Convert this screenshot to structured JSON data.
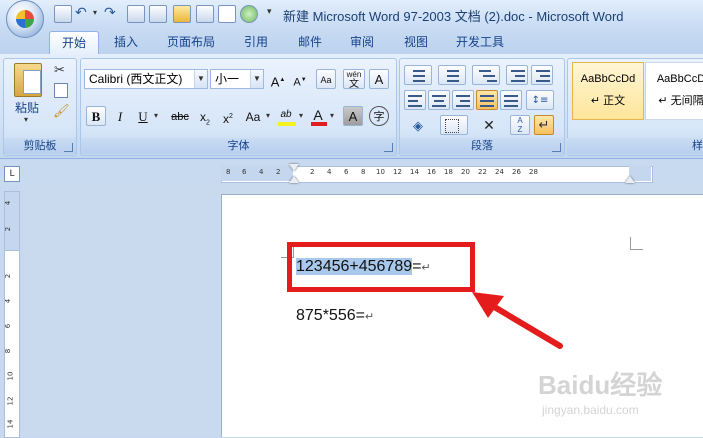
{
  "window": {
    "title": "新建 Microsoft Word 97-2003 文档 (2).doc - Microsoft Word"
  },
  "quick_access": {
    "icons": [
      "save-icon",
      "undo-icon",
      "redo-icon",
      "format-icon",
      "open-icon",
      "print-icon",
      "spellcheck-icon",
      "circle-icon"
    ]
  },
  "tabs": [
    "开始",
    "插入",
    "页面布局",
    "引用",
    "邮件",
    "审阅",
    "视图",
    "开发工具"
  ],
  "active_tab": "开始",
  "ribbon": {
    "clipboard": {
      "paste_label": "粘贴",
      "group_label": "剪贴板"
    },
    "font": {
      "font_name": "Calibri (西文正文)",
      "font_size": "小一",
      "group_label": "字体",
      "buttons": {
        "grow": "A",
        "shrink": "A",
        "clear": "Aa",
        "phonetic": "wén",
        "char_border": "A",
        "bold": "B",
        "italic": "I",
        "underline": "U",
        "strike": "abc",
        "subscript": "x",
        "superscript": "x",
        "change_case": "Aa",
        "highlight": "ab",
        "font_color": "A",
        "char_shading": "A",
        "enclose": "字"
      }
    },
    "paragraph": {
      "group_label": "段落"
    },
    "styles": {
      "items": [
        {
          "sample": "AaBbCcDd",
          "name": "↵ 正文"
        },
        {
          "sample": "AaBbCcD",
          "name": "↵ 无间隔"
        }
      ],
      "group_label": "样"
    }
  },
  "ruler": {
    "top_ticks": [
      "8",
      "6",
      "4",
      "2",
      "2",
      "4",
      "6",
      "8",
      "10",
      "12",
      "14",
      "16",
      "18",
      "20",
      "22",
      "24",
      "26",
      "28"
    ],
    "left_ticks": [
      "4",
      "2",
      "2",
      "4",
      "6",
      "8",
      "10",
      "12",
      "14"
    ]
  },
  "document": {
    "line1_selected": "123456+456789",
    "line1_rest": "=",
    "line2": "875*556=",
    "para_mark": "↵"
  },
  "watermark": {
    "brand": "Baidu经验",
    "url": "jingyan.baidu.com"
  },
  "colors": {
    "annotation_red": "#e41c1c",
    "selection": "#a8c8ec"
  }
}
